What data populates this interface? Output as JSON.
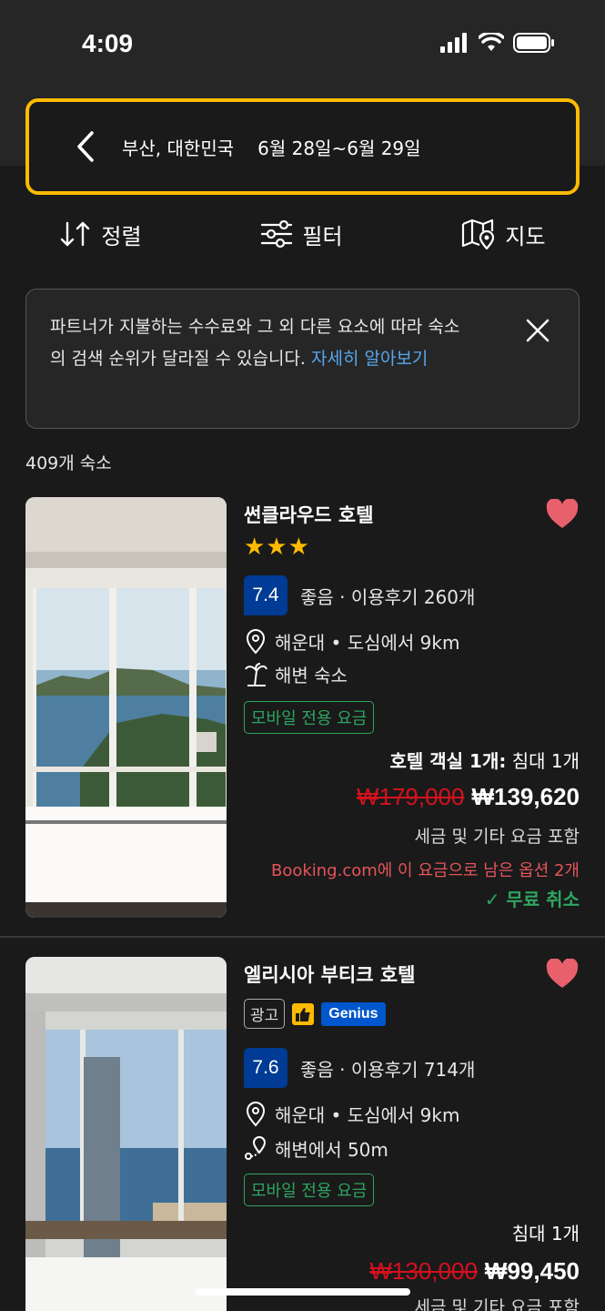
{
  "status": {
    "time": "4:09"
  },
  "search": {
    "location": "부산, 대한민국",
    "dates": "6월 28일~6월 29일"
  },
  "actions": {
    "sort": "정렬",
    "filter": "필터",
    "map": "지도"
  },
  "notice": {
    "text": "파트너가 지불하는 수수료와 그 외 다른 요소에 따라 숙소의 검색 순위가 달라질 수 있습니다.",
    "link": "자세히 알아보기"
  },
  "results_count": "409개 숙소",
  "hotels": [
    {
      "name": "썬클라우드 호텔",
      "stars": "★★★",
      "score": "7.4",
      "score_label": "좋음 · 이용후기 260개",
      "location": "해운대 • 도심에서 9km",
      "feature": "해변 숙소",
      "badge": "모바일 전용 요금",
      "room_bold": "호텔 객실 1개:",
      "room_rest": " 침대 1개",
      "old_price": "₩179,000",
      "price": "₩139,620",
      "tax": "세금 및 기타 요금 포함",
      "remain": "Booking.com에 이 요금으로 남은 옵션 2개",
      "free_cancel": "✓ 무료 취소"
    },
    {
      "name": "엘리시아 부티크 호텔",
      "ad": "광고",
      "genius": "Genius",
      "score": "7.6",
      "score_label": "좋음 · 이용후기 714개",
      "location": "해운대 • 도심에서 9km",
      "feature": "해변에서 50m",
      "badge": "모바일 전용 요금",
      "room_rest": "침대 1개",
      "old_price": "₩130,000",
      "price": "₩99,450",
      "tax": "세금 및 기타 요금 포함"
    }
  ],
  "colors": {
    "accent": "#febb02",
    "score_bg": "#003b95",
    "green": "#2ea55f",
    "red": "#d4111e",
    "link": "#57a6f0",
    "heart": "#e8606c"
  }
}
